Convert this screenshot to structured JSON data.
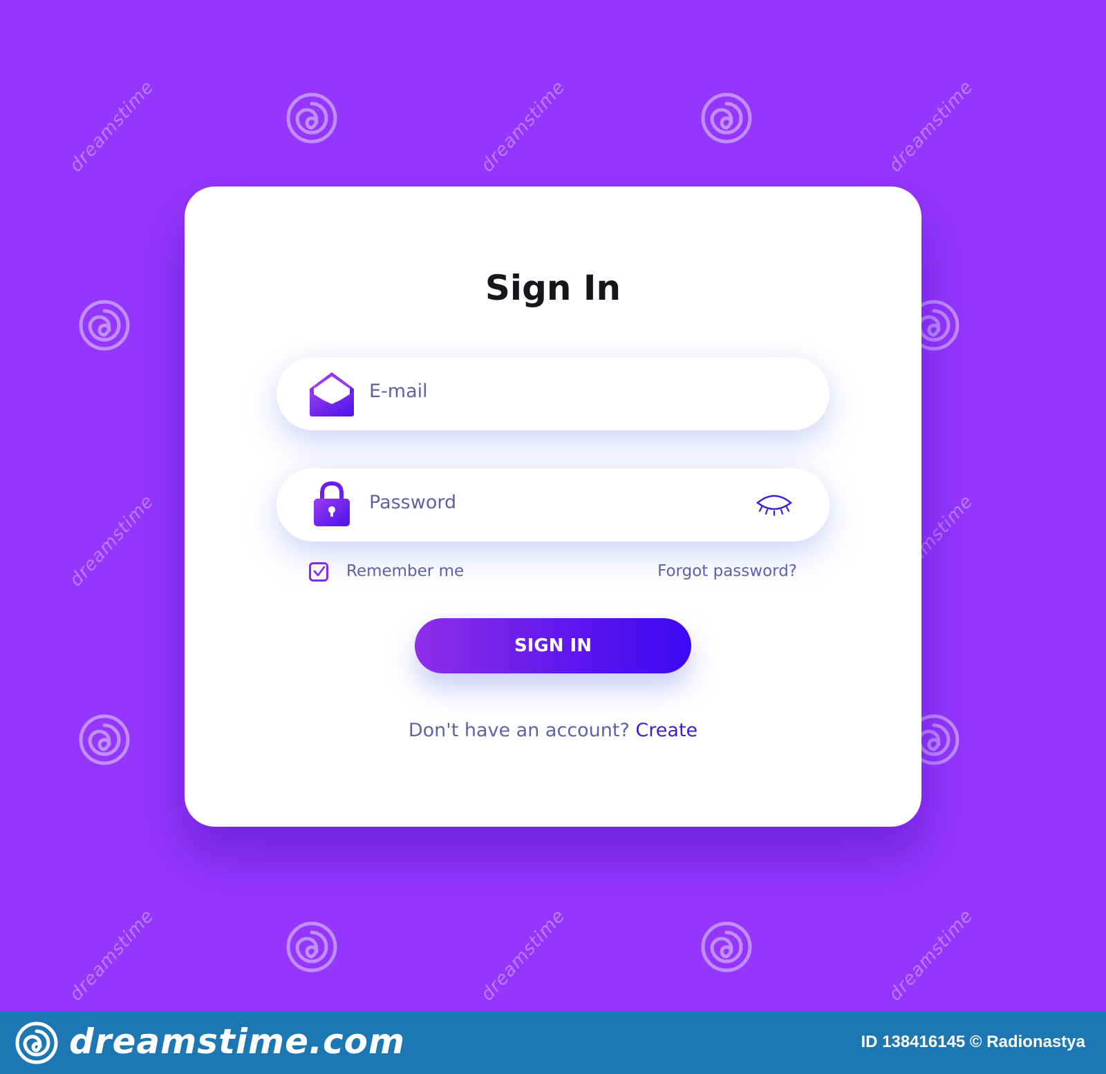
{
  "form": {
    "title": "Sign In",
    "email_placeholder": "E-mail",
    "password_placeholder": "Password",
    "remember_label": "Remember me",
    "remember_checked": true,
    "forgot_label": "Forgot password?",
    "submit_label": "SIGN IN",
    "signup_prompt": "Don't have an account?",
    "signup_link": "Create"
  },
  "icons": {
    "email": "envelope-icon",
    "password": "lock-icon",
    "visibility": "eye-closed-icon",
    "checkbox": "checkmark-icon"
  },
  "colors": {
    "background": "#9536fc",
    "card": "#ffffff",
    "accent": "#7b2cf0",
    "button_start": "#8f2ee9",
    "button_end": "#3c08f2",
    "text_muted": "#5d62a8",
    "link": "#3a1fd6",
    "footer": "#1c77b2"
  },
  "watermark": {
    "site": "dreamstime.com",
    "tile_text": "dreamstime",
    "credit": "ID 138416145 © Radionastya"
  }
}
